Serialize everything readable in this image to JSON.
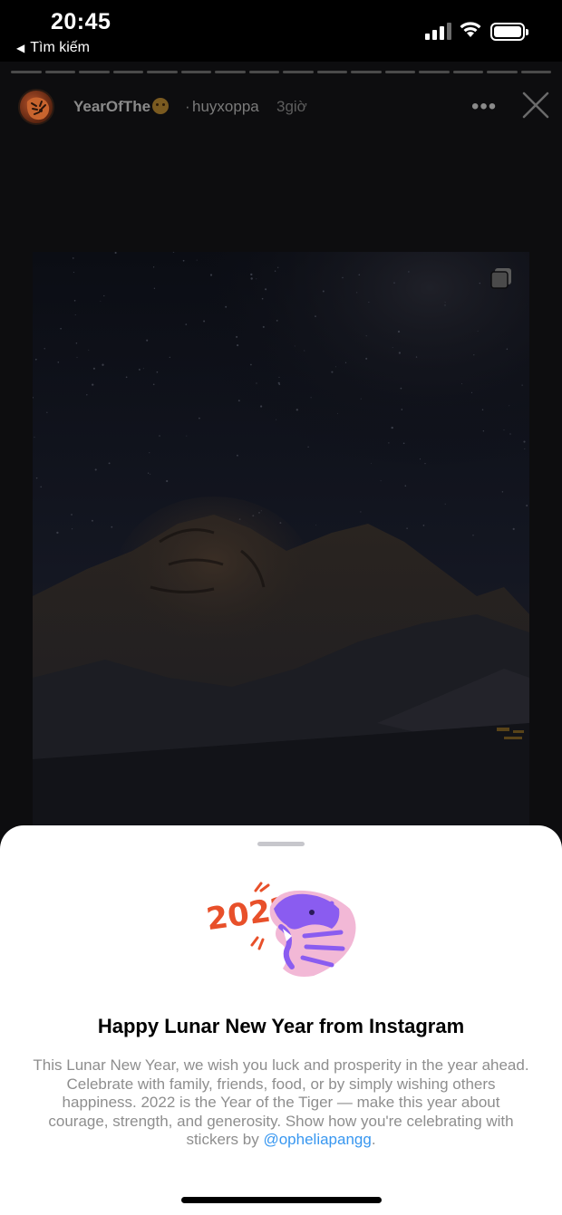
{
  "status_bar": {
    "time": "20:45",
    "back_label": "Tìm kiếm",
    "back_icon": "back-triangle-icon"
  },
  "story": {
    "segment_count": 16,
    "username": "YearOfThe",
    "username_emoji": "tiger-face-icon",
    "separator": "·",
    "song": "huyxoppa",
    "time_ago": "3giờ",
    "more_label": "•••"
  },
  "sheet": {
    "sticker_text": "2022",
    "title": "Happy Lunar New Year from Instagram",
    "body": "This Lunar New Year, we wish you luck and prosperity in the year ahead. Celebrate with family, friends, food, or by simply wishing others happiness. 2022 is the Year of the Tiger — make this year about courage, strength, and generosity. Show how you're celebrating with stickers by ",
    "mention": "@opheliapangg",
    "body_end": "."
  },
  "colors": {
    "mention": "#3897f0",
    "sticker_orange": "#e8502a",
    "sticker_purple": "#8a5cf0",
    "sticker_pink": "#f2b8d6"
  }
}
